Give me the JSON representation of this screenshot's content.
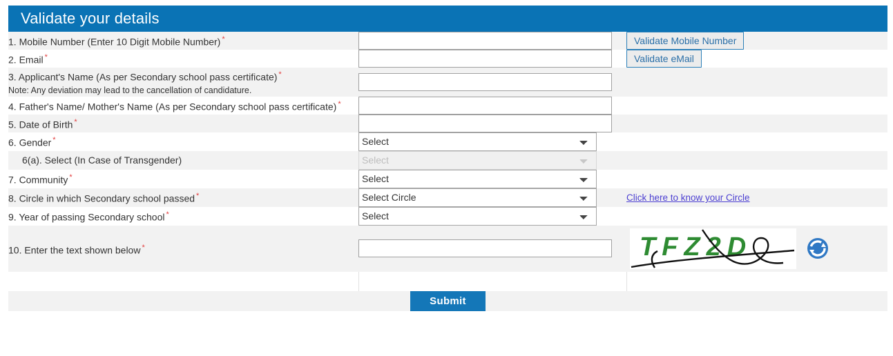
{
  "header": {
    "title": "Validate your details"
  },
  "rows": [
    {
      "label": "1. Mobile Number (Enter 10 Digit Mobile Number)",
      "required": true,
      "field": {
        "type": "text",
        "value": "",
        "placeholder": ""
      },
      "extra": {
        "type": "button",
        "label": "Validate Mobile Number"
      }
    },
    {
      "label": "2. Email",
      "required": true,
      "field": {
        "type": "text",
        "value": "",
        "placeholder": ""
      },
      "extra": {
        "type": "button",
        "label": "Validate eMail"
      }
    },
    {
      "label": "3. Applicant's Name (As per Secondary school pass certificate)",
      "required": true,
      "note": "Note: Any deviation may lead to the cancellation of candidature.",
      "field": {
        "type": "text",
        "value": "",
        "placeholder": ""
      },
      "extra": null
    },
    {
      "label": "4. Father's Name/ Mother's Name (As per Secondary school pass certificate)",
      "required": true,
      "field": {
        "type": "text",
        "value": "",
        "placeholder": ""
      },
      "extra": null
    },
    {
      "label": "5. Date of Birth",
      "required": true,
      "field": {
        "type": "text",
        "value": "",
        "placeholder": ""
      },
      "extra": null
    },
    {
      "label": "6. Gender",
      "required": true,
      "field": {
        "type": "select",
        "value": "Select",
        "disabled": false
      },
      "extra": null
    },
    {
      "label": "6(a). Select (In Case of Transgender)",
      "required": false,
      "indent": true,
      "field": {
        "type": "select",
        "value": "Select",
        "disabled": true
      },
      "extra": null
    },
    {
      "label": "7. Community",
      "required": true,
      "field": {
        "type": "select",
        "value": "Select",
        "disabled": false
      },
      "extra": null
    },
    {
      "label": "8. Circle in which Secondary school passed",
      "required": true,
      "field": {
        "type": "select",
        "value": "Select Circle",
        "disabled": false
      },
      "extra": {
        "type": "link",
        "label": "Click here to know your Circle"
      }
    },
    {
      "label": "9. Year of passing Secondary school",
      "required": true,
      "field": {
        "type": "select",
        "value": "Select",
        "disabled": false
      },
      "extra": null
    },
    {
      "label": "10. Enter the text shown below",
      "required": true,
      "field": {
        "type": "text",
        "value": "",
        "placeholder": ""
      },
      "extra": {
        "type": "captcha",
        "text": "TFZ2D",
        "refresh_icon": "refresh-icon"
      }
    }
  ],
  "footer": {
    "submit_label": "Submit"
  },
  "colors": {
    "header_bg": "#0a73b5",
    "submit_bg": "#1477b8",
    "required_star": "#e23b3b",
    "captcha_text": "#2e8b32",
    "link": "#4b3ed1",
    "row_alt_bg": "#f2f2f2"
  }
}
